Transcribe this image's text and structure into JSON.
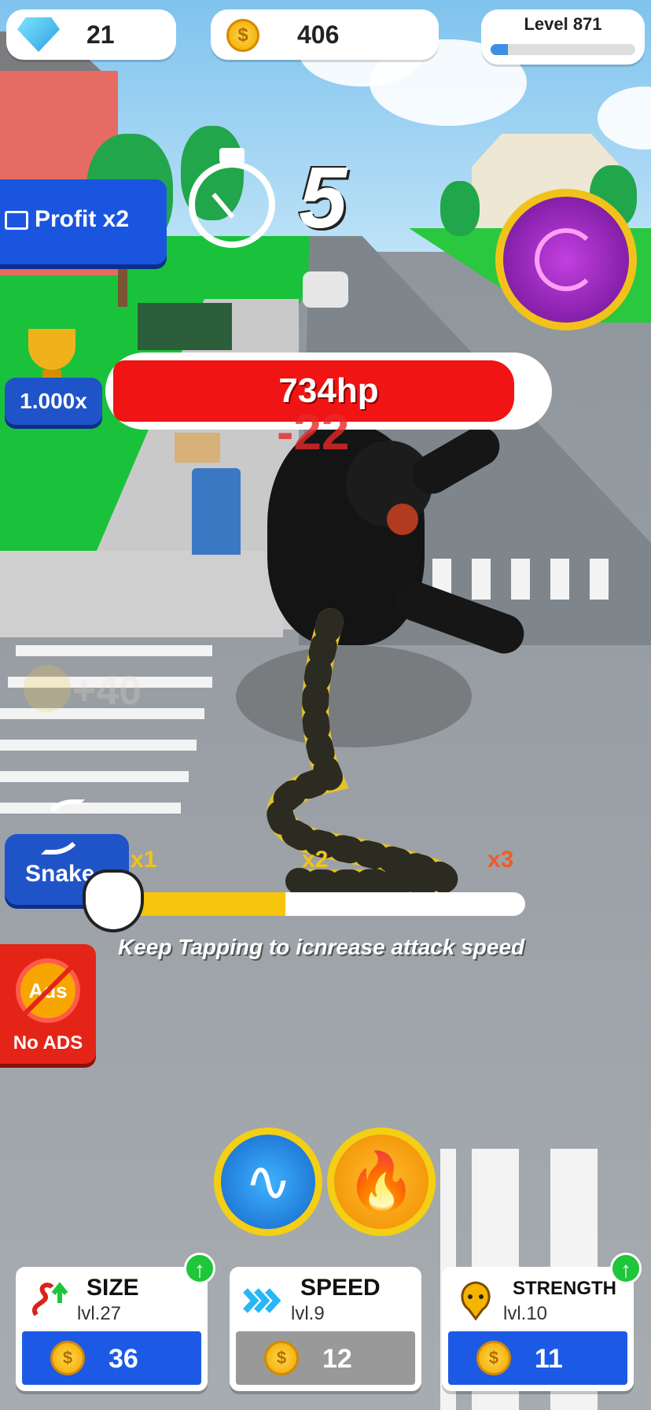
{
  "hud": {
    "gems": "21",
    "coins": "406",
    "level_label": "Level 871",
    "level_progress_percent": 12
  },
  "profit": {
    "label": "Profit x2"
  },
  "timer": {
    "seconds": "5"
  },
  "multiplier": {
    "value": "1.000x"
  },
  "boss": {
    "hp_label": "734hp",
    "hp_fill_percent": 93,
    "damage_popup": "-22"
  },
  "ghost_reward": {
    "text": "+40"
  },
  "snake_panel": {
    "label": "Snake",
    "marks": [
      "x1",
      "x2",
      "x3"
    ],
    "progress_percent": 40,
    "hint": "Keep Tapping to icnrease attack speed"
  },
  "no_ads": {
    "icon_text": "Ads",
    "label": "No ADS"
  },
  "skills": [
    {
      "icon": "snake-icon",
      "glyph": "∿"
    },
    {
      "icon": "fire-icon",
      "glyph": "🔥"
    }
  ],
  "upgrades": {
    "size": {
      "title": "SIZE",
      "level": "lvl.27",
      "price": "36",
      "affordable": true
    },
    "speed": {
      "title": "SPEED",
      "level": "lvl.9",
      "price": "12",
      "affordable": false
    },
    "strength": {
      "title": "STRENGTH",
      "level": "lvl.10",
      "price": "11",
      "affordable": true
    }
  },
  "colors": {
    "primary_blue": "#1f54c9",
    "hp_red": "#f01414",
    "gold": "#f4cf14",
    "no_ads_red": "#e42416",
    "upgrade_green": "#1ec63a"
  }
}
